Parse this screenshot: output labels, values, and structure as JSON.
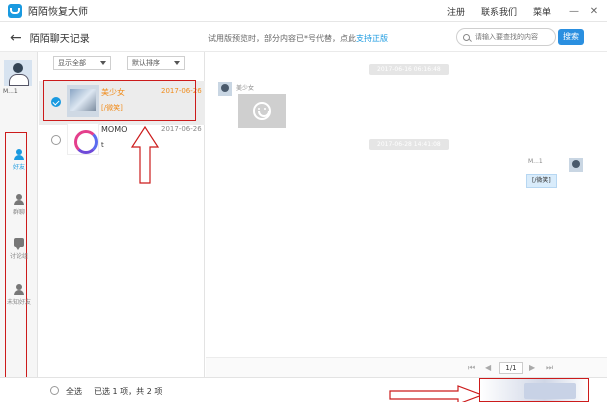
{
  "titlebar": {
    "app_title": "陌陌恢复大师",
    "nav": [
      "注册",
      "联系我们",
      "菜单"
    ],
    "minimize": "—",
    "close": "✕"
  },
  "subbar": {
    "back": "←",
    "page_title": "陌陌聊天记录",
    "notice": "试用版预览时，部分内容已*号代替，点此",
    "notice_link": "支持正版",
    "search_placeholder": "请输入要查找的内容",
    "search_button": "搜索"
  },
  "sidebar": {
    "avatar_caption": "M...1",
    "items": [
      {
        "label": "好友",
        "icon": "person-icon"
      },
      {
        "label": "群聊",
        "icon": "group-icon"
      },
      {
        "label": "讨论组",
        "icon": "chat-bubble-icon"
      },
      {
        "label": "未知好友",
        "icon": "unknown-person-icon"
      }
    ]
  },
  "list": {
    "filter_show": "显示全部",
    "filter_sort": "默认排序",
    "contacts": [
      {
        "name": "美少女",
        "preview": "[/微笑]",
        "date": "2017-06-26",
        "selected": true
      },
      {
        "name": "MOMO",
        "preview": "t",
        "date": "2017-06-26",
        "selected": false
      }
    ]
  },
  "chat": {
    "time1": "2017-06-16 06:16:48",
    "sender": "美少女",
    "time2": "2017-06-28 14:41:08",
    "outgoing_text": "[/微笑]",
    "outgoing_sender": "M...1"
  },
  "pager": {
    "current": "1/1",
    "first": "⏮",
    "prev": "◀",
    "next": "▶",
    "last": "⏭"
  },
  "footer": {
    "select_all": "全选",
    "count": "已选 1 项，共 2 项"
  },
  "colors": {
    "accent": "#1a9ae0",
    "highlight": "#f08c1c",
    "annotation": "#cc1b1b"
  }
}
